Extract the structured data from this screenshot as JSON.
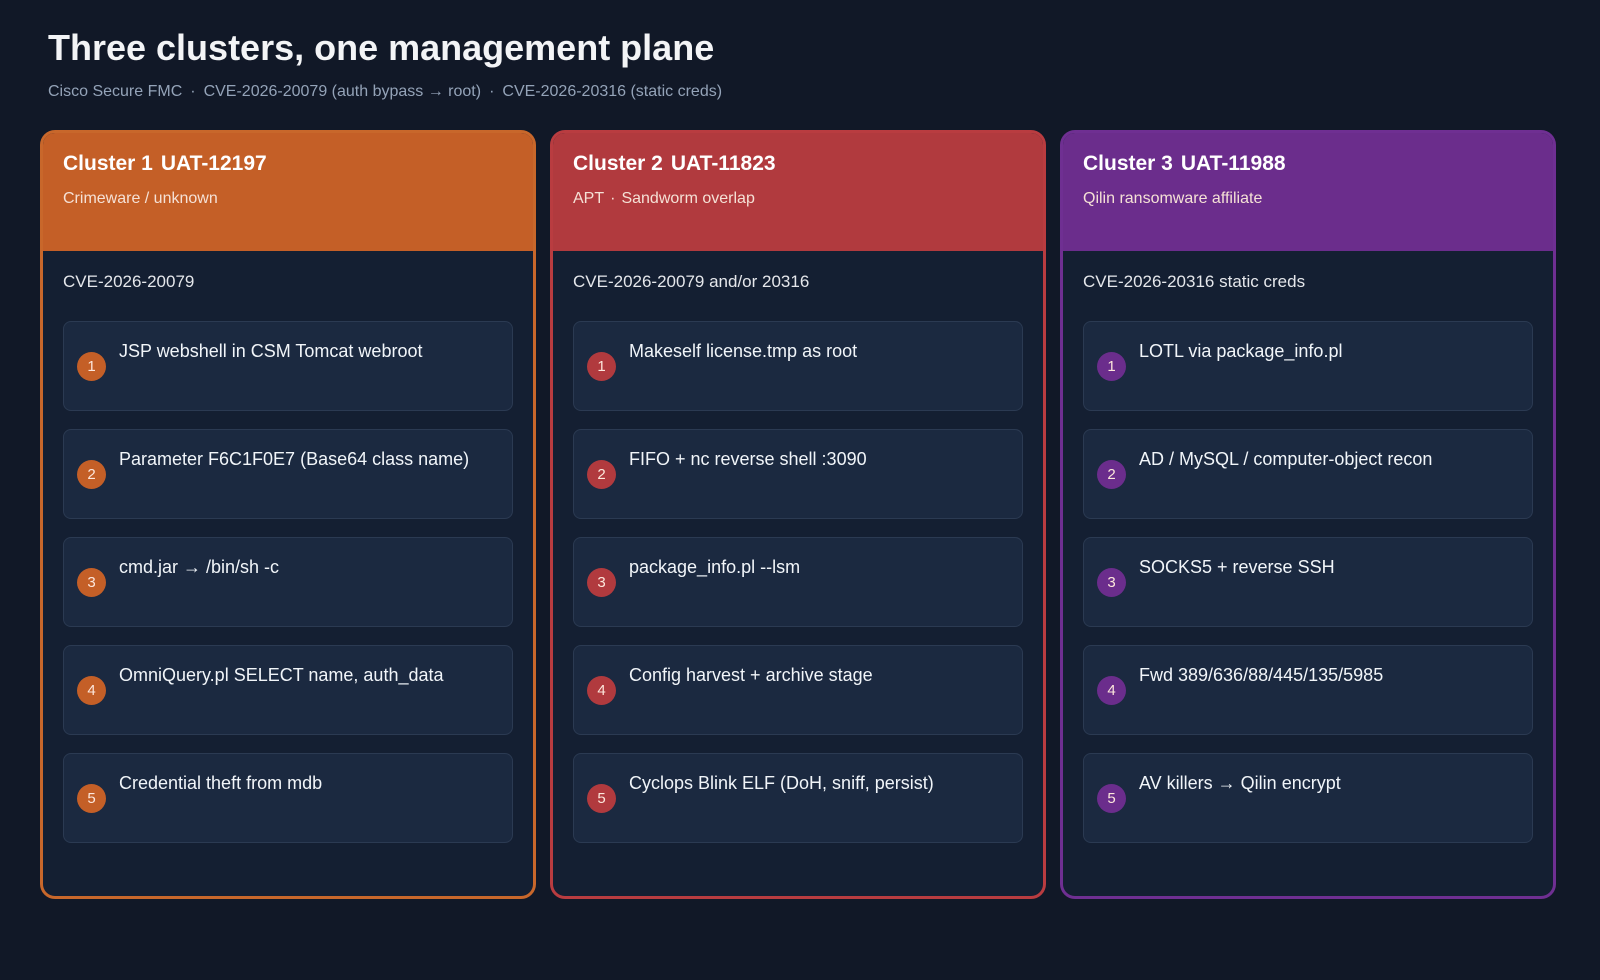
{
  "header": {
    "title": "Three clusters, one management plane",
    "subtitle_parts": [
      "Cisco Secure FMC",
      "CVE-2026-20079 (auth bypass → root)",
      "CVE-2026-20316 (static creds)"
    ],
    "separator": "·"
  },
  "clusters": [
    {
      "name": "Cluster 1",
      "id": "UAT-12197",
      "tagline": "Crimeware / unknown",
      "tagline_extra": "",
      "cve": "CVE-2026-20079",
      "color": "#c45f27",
      "border_color": "#c8672b",
      "steps": [
        {
          "n": "1",
          "label": "JSP webshell in CSM Tomcat webroot"
        },
        {
          "n": "2",
          "label": "Parameter F6C1F0E7 (Base64 class name)"
        },
        {
          "n": "3",
          "label": "cmd.jar → /bin/sh -c"
        },
        {
          "n": "4",
          "label": "OmniQuery.pl SELECT name, auth_data"
        },
        {
          "n": "5",
          "label": "Credential theft from mdb"
        }
      ]
    },
    {
      "name": "Cluster 2",
      "id": "UAT-11823",
      "tagline": "APT",
      "tagline_extra": "Sandworm overlap",
      "cve": "CVE-2026-20079 and/or 20316",
      "color": "#b13a3e",
      "border_color": "#b93c40",
      "steps": [
        {
          "n": "1",
          "label": "Makeself license.tmp as root"
        },
        {
          "n": "2",
          "label": "FIFO + nc reverse shell :3090"
        },
        {
          "n": "3",
          "label": "package_info.pl --lsm"
        },
        {
          "n": "4",
          "label": "Config harvest + archive stage"
        },
        {
          "n": "5",
          "label": "Cyclops Blink ELF (DoH, sniff, persist)"
        }
      ]
    },
    {
      "name": "Cluster 3",
      "id": "UAT-11988",
      "tagline": "Qilin ransomware affiliate",
      "tagline_extra": "",
      "cve": "CVE-2026-20316 static creds",
      "color": "#6b2d8c",
      "border_color": "#6f2f92",
      "steps": [
        {
          "n": "1",
          "label": "LOTL via package_info.pl"
        },
        {
          "n": "2",
          "label": "AD / MySQL / computer-object recon"
        },
        {
          "n": "3",
          "label": "SOCKS5 + reverse SSH"
        },
        {
          "n": "4",
          "label": "Fwd 389/636/88/445/135/5985"
        },
        {
          "n": "5",
          "label": "AV killers → Qilin encrypt"
        }
      ]
    }
  ]
}
